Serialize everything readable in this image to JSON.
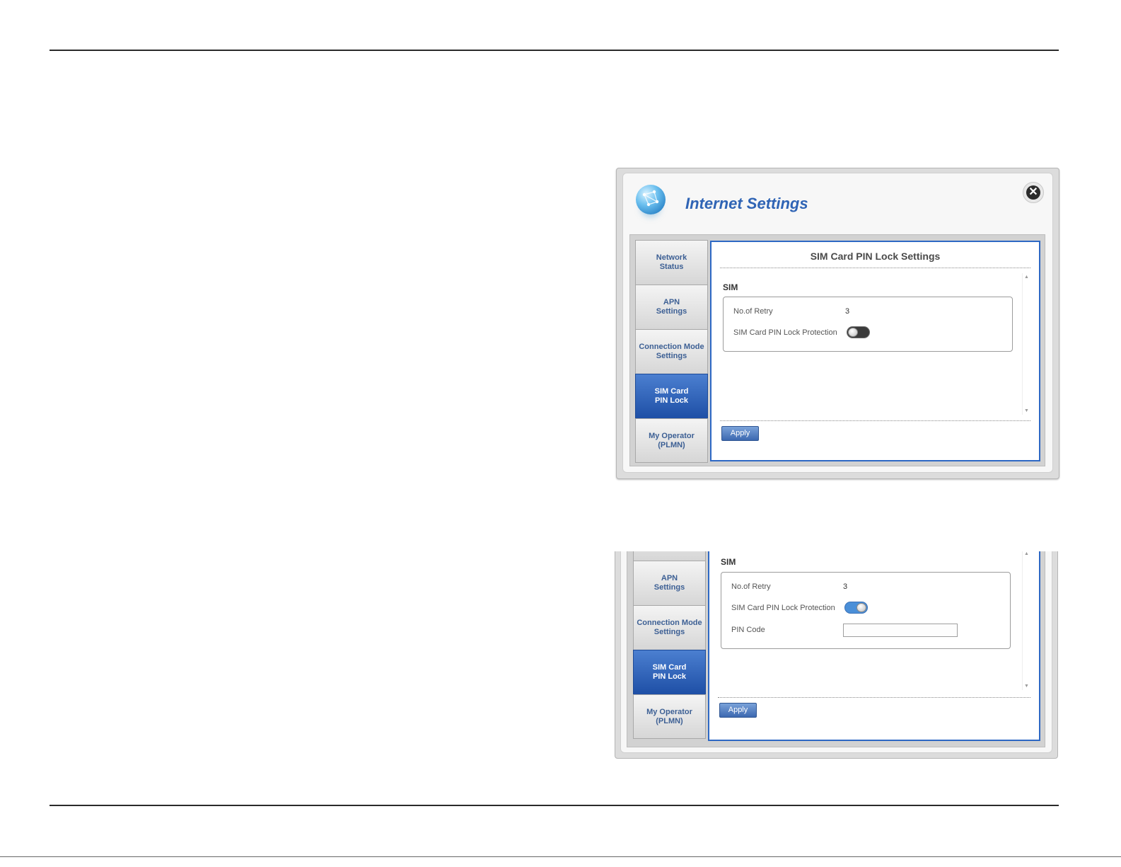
{
  "dialog": {
    "title": "Internet Settings",
    "close_icon": "close-icon",
    "logo_icon": "globe-network-icon",
    "sidebar": {
      "items": [
        {
          "line1": "Network",
          "line2": "Status",
          "active": false
        },
        {
          "line1": "APN",
          "line2": "Settings",
          "active": false
        },
        {
          "line1": "Connection Mode",
          "line2": "Settings",
          "active": false
        },
        {
          "line1": "SIM Card",
          "line2": "PIN Lock",
          "active": true
        },
        {
          "line1": "My Operator",
          "line2": "(PLMN)",
          "active": false
        }
      ]
    },
    "content": {
      "heading": "SIM Card PIN Lock Settings",
      "section_label": "SIM",
      "retry_label": "No.of Retry",
      "retry_value": "3",
      "protection_label": "SIM Card PIN Lock Protection",
      "protection_enabled": false,
      "apply_label": "Apply"
    }
  },
  "dialog2": {
    "sidebar": {
      "items": [
        {
          "line1": "APN",
          "line2": "Settings",
          "active": false
        },
        {
          "line1": "Connection Mode",
          "line2": "Settings",
          "active": false
        },
        {
          "line1": "SIM Card",
          "line2": "PIN Lock",
          "active": true
        },
        {
          "line1": "My Operator",
          "line2": "(PLMN)",
          "active": false
        }
      ]
    },
    "content": {
      "section_label": "SIM",
      "retry_label": "No.of Retry",
      "retry_value": "3",
      "protection_label": "SIM Card PIN Lock Protection",
      "protection_enabled": true,
      "pin_label": "PIN Code",
      "pin_value": "",
      "apply_label": "Apply"
    }
  },
  "colors": {
    "accent": "#2d68c4",
    "active_tab": "#1e4fa6",
    "title": "#2f64b5"
  }
}
